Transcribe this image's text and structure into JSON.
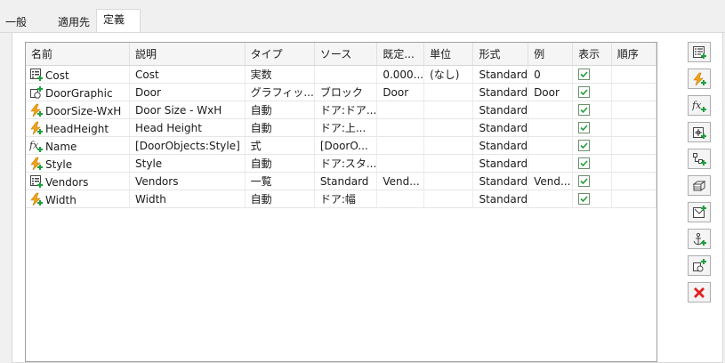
{
  "tabs": [
    {
      "label": "一般"
    },
    {
      "label": "適用先"
    },
    {
      "label": "定義"
    }
  ],
  "active_tab": "定義",
  "table": {
    "columns": [
      "名前",
      "説明",
      "タイプ",
      "ソース",
      "既定...",
      "単位",
      "形式",
      "例",
      "表示",
      "順序"
    ],
    "rows": [
      {
        "icon": "list-icon",
        "name": "Cost",
        "description": "Cost",
        "type": "実数",
        "source": "",
        "default": "0.000...",
        "unit": "(なし)",
        "format": "Standard",
        "example": "0",
        "visible": true,
        "order": ""
      },
      {
        "icon": "graphic-icon",
        "name": "DoorGraphic",
        "description": "Door",
        "type": "グラフィッ...",
        "source": "ブロック",
        "default": "Door",
        "unit": "",
        "format": "Standard",
        "example": "Door",
        "visible": true,
        "order": ""
      },
      {
        "icon": "lightning-icon",
        "name": "DoorSize-WxH",
        "description": "Door Size - WxH",
        "type": "自動",
        "source": "ドア:ドア...",
        "default": "",
        "unit": "",
        "format": "Standard",
        "example": "",
        "visible": true,
        "order": ""
      },
      {
        "icon": "lightning-icon",
        "name": "HeadHeight",
        "description": "Head Height",
        "type": "自動",
        "source": "ドア:上...",
        "default": "",
        "unit": "",
        "format": "Standard",
        "example": "",
        "visible": true,
        "order": ""
      },
      {
        "icon": "formula-icon",
        "name": "Name",
        "description": "[DoorObjects:Style]",
        "type": "式",
        "source": "[DoorO...",
        "default": "",
        "unit": "",
        "format": "Standard",
        "example": "",
        "visible": true,
        "order": ""
      },
      {
        "icon": "lightning-icon",
        "name": "Style",
        "description": "Style",
        "type": "自動",
        "source": "ドア:スタ...",
        "default": "",
        "unit": "",
        "format": "Standard",
        "example": "",
        "visible": true,
        "order": ""
      },
      {
        "icon": "list-icon",
        "name": "Vendors",
        "description": "Vendors",
        "type": "一覧",
        "source": "Standard",
        "default": "Vend...",
        "unit": "",
        "format": "Standard",
        "example": "Vend...",
        "visible": true,
        "order": ""
      },
      {
        "icon": "lightning-icon",
        "name": "Width",
        "description": "Width",
        "type": "自動",
        "source": "ドア:幅",
        "default": "",
        "unit": "",
        "format": "Standard",
        "example": "",
        "visible": true,
        "order": ""
      }
    ]
  },
  "toolbar": [
    {
      "name": "add-list-definition-button",
      "icon": "list-add-icon"
    },
    {
      "name": "add-automatic-property-button",
      "icon": "lightning-add-icon"
    },
    {
      "name": "add-formula-property-button",
      "icon": "formula-add-icon"
    },
    {
      "name": "add-location-property-button",
      "icon": "location-add-icon"
    },
    {
      "name": "add-classification-property-button",
      "icon": "classification-add-icon"
    },
    {
      "name": "add-material-property-button",
      "icon": "material-add-icon"
    },
    {
      "name": "add-graphic-property-button",
      "icon": "graphic-add-icon"
    },
    {
      "name": "add-anchor-property-button",
      "icon": "anchor-add-icon"
    },
    {
      "name": "add-block-property-button",
      "icon": "block-add-icon"
    },
    {
      "name": "delete-property-button",
      "icon": "delete-icon"
    }
  ]
}
